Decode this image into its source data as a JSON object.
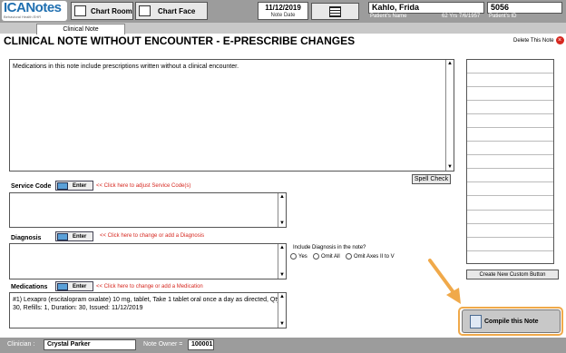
{
  "header": {
    "logo_text_main": "ICANotes",
    "logo_subtext": "Behavioral Health EHR",
    "chart_room_label": "Chart Room",
    "chart_face_label": "Chart Face",
    "note_date_value": "11/12/2019",
    "note_date_label": "Note Date",
    "patient_name_value": "Kahlo, Frida",
    "patient_name_label": "Patient's Name",
    "patient_age_dob": "62 Yrs 7/6/1957",
    "patient_id_value": "5056",
    "patient_id_label": "Patient's ID"
  },
  "tab": {
    "label": "Clinical Note"
  },
  "page": {
    "title": "CLINICAL NOTE WITHOUT ENCOUNTER - E-PRESCRIBE CHANGES",
    "delete_label": "Delete This Note"
  },
  "note": {
    "text": "Medications in this note include prescriptions written without a clinical encounter.",
    "spell_check_label": "Spell Check"
  },
  "service_code": {
    "label": "Service Code",
    "enter_label": "Enter",
    "hint": "<< Click here to adjust Service Code(s)",
    "text": ""
  },
  "diagnosis": {
    "label": "Diagnosis",
    "enter_label": "Enter",
    "hint": "<< Click here to change or add a Diagnosis",
    "text": "",
    "include_label": "Include Diagnosis in the note?",
    "options": [
      "Yes",
      "Omit All",
      "Omit Axes II to V"
    ]
  },
  "medications": {
    "label": "Medications",
    "enter_label": "Enter",
    "hint": "<< Click here to change or add a Medication",
    "text": "#1) Lexapro (escitalopram oxalate) 10 mg, tablet, Take 1 tablet oral once a day as directed, Qty: 30, Refills: 1, Duration: 30, Issued: 11/12/2019"
  },
  "sidebar": {
    "create_button_label": "Create New Custom Button",
    "compile_label": "Compile this Note"
  },
  "footer": {
    "clinician_label": "Clinician :",
    "clinician_value": "Crystal Parker",
    "owner_label": "Note Owner =",
    "owner_value": "100001"
  },
  "colors": {
    "accent_orange": "#f0a94a",
    "link_red": "#d6271f",
    "bar_gray": "#9c9c9c"
  },
  "icons": [
    "chart-room-icon",
    "chart-face-icon",
    "calendar-icon",
    "delete-icon",
    "enter-icon",
    "compile-icon",
    "pointer-arrow-icon"
  ]
}
